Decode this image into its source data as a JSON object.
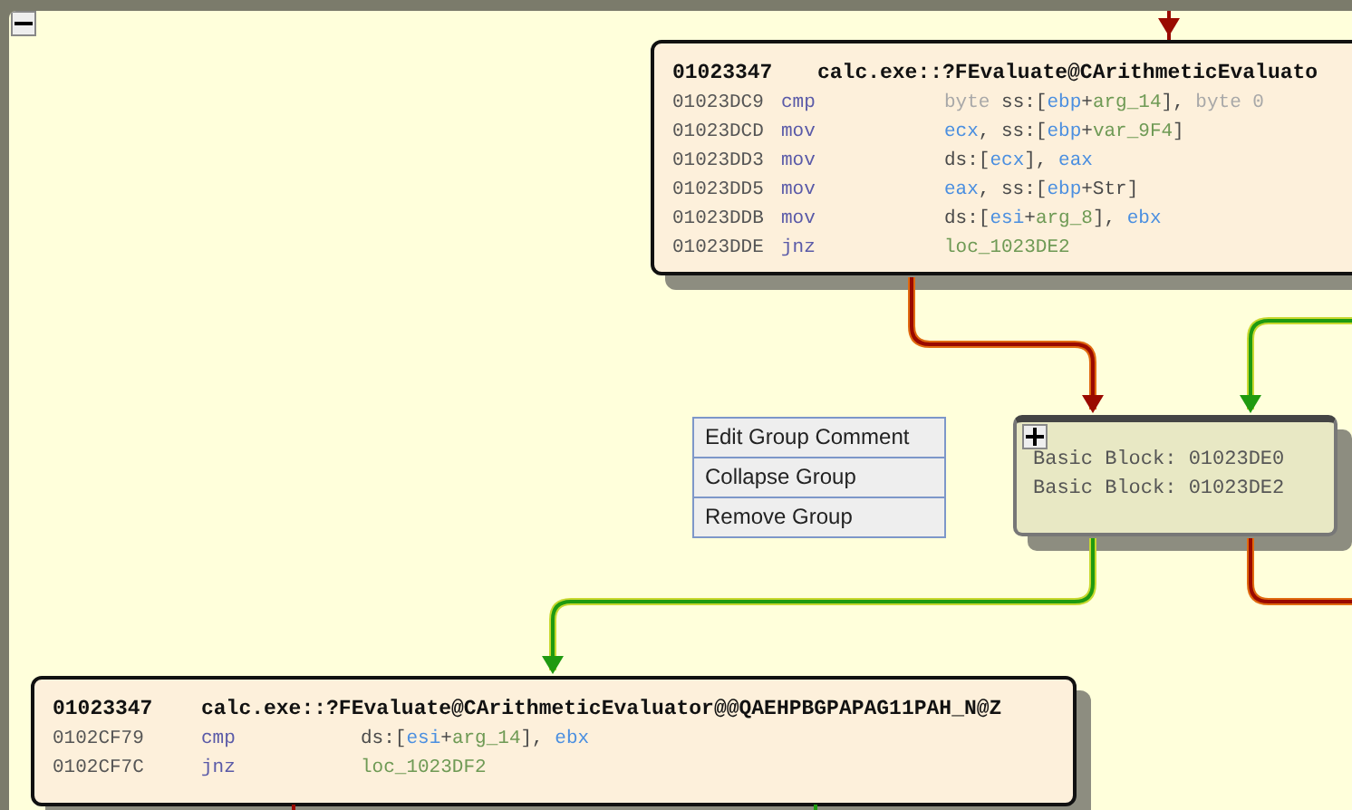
{
  "graph": {
    "group_toggle": {
      "expanded": true
    },
    "blocks": [
      {
        "address": "01023347",
        "name": "calc.exe::?FEvaluate@CArithmeticEvaluato",
        "lines": [
          {
            "address": "01023DC9",
            "mnemonic": "cmp",
            "operands": [
              {
                "kind": "keyword",
                "text": "byte"
              },
              {
                "kind": "plain",
                "text": " ss:["
              },
              {
                "kind": "register",
                "text": "ebp"
              },
              {
                "kind": "plain",
                "text": "+"
              },
              {
                "kind": "variable",
                "text": "arg_14"
              },
              {
                "kind": "plain",
                "text": "], "
              },
              {
                "kind": "keyword",
                "text": "byte 0"
              }
            ]
          },
          {
            "address": "01023DCD",
            "mnemonic": "mov",
            "operands": [
              {
                "kind": "register",
                "text": "ecx"
              },
              {
                "kind": "plain",
                "text": ", ss:["
              },
              {
                "kind": "register",
                "text": "ebp"
              },
              {
                "kind": "plain",
                "text": "+"
              },
              {
                "kind": "variable",
                "text": "var_9F4"
              },
              {
                "kind": "plain",
                "text": "]"
              }
            ]
          },
          {
            "address": "01023DD3",
            "mnemonic": "mov",
            "operands": [
              {
                "kind": "plain",
                "text": "ds:["
              },
              {
                "kind": "register",
                "text": "ecx"
              },
              {
                "kind": "plain",
                "text": "], "
              },
              {
                "kind": "register",
                "text": "eax"
              }
            ]
          },
          {
            "address": "01023DD5",
            "mnemonic": "mov",
            "operands": [
              {
                "kind": "register",
                "text": "eax"
              },
              {
                "kind": "plain",
                "text": ", ss:["
              },
              {
                "kind": "register",
                "text": "ebp"
              },
              {
                "kind": "plain",
                "text": "+Str]"
              }
            ]
          },
          {
            "address": "01023DDB",
            "mnemonic": "mov",
            "operands": [
              {
                "kind": "plain",
                "text": "ds:["
              },
              {
                "kind": "register",
                "text": "esi"
              },
              {
                "kind": "plain",
                "text": "+"
              },
              {
                "kind": "variable",
                "text": "arg_8"
              },
              {
                "kind": "plain",
                "text": "], "
              },
              {
                "kind": "register",
                "text": "ebx"
              }
            ]
          },
          {
            "address": "01023DDE",
            "mnemonic": "jnz",
            "operands": [
              {
                "kind": "variable",
                "text": "loc_1023DE2"
              }
            ]
          }
        ]
      },
      {
        "address": "01023347",
        "name": "calc.exe::?FEvaluate@CArithmeticEvaluator@@QAEHPBGPAPAG11PAH_N@Z",
        "lines": [
          {
            "address": "0102CF79",
            "mnemonic": "cmp",
            "operands": [
              {
                "kind": "plain",
                "text": "ds:["
              },
              {
                "kind": "register",
                "text": "esi"
              },
              {
                "kind": "plain",
                "text": "+"
              },
              {
                "kind": "variable",
                "text": "arg_14"
              },
              {
                "kind": "plain",
                "text": "], "
              },
              {
                "kind": "register",
                "text": "ebx"
              }
            ]
          },
          {
            "address": "0102CF7C",
            "mnemonic": "jnz",
            "operands": [
              {
                "kind": "variable",
                "text": "loc_1023DF2"
              }
            ]
          }
        ]
      }
    ],
    "group": {
      "expanded": false,
      "lines": [
        "Basic Block: 01023DE0",
        "Basic Block: 01023DE2"
      ]
    },
    "context_menu": {
      "items": [
        "Edit Group Comment",
        "Collapse Group",
        "Remove Group"
      ]
    }
  }
}
